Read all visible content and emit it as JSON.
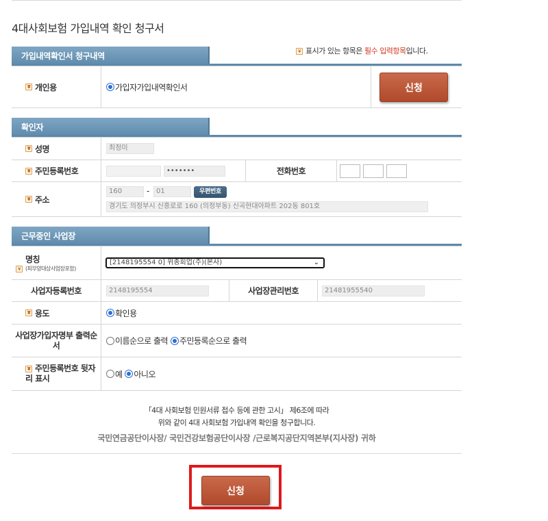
{
  "page": {
    "title": "4대사회보험 가입내역 확인 청구서"
  },
  "required_note": {
    "prefix": "표시가 있는 항목은 ",
    "highlight": "필수 입력항목",
    "suffix": "입니다."
  },
  "required_marker": "¥",
  "section1": {
    "title": "가입내역확인서 청구내역",
    "label": "개인용",
    "option": "가입자가입내역확인서",
    "button": "신청"
  },
  "section2": {
    "title": "확인자",
    "name_label": "성명",
    "name_value": "최정미",
    "rrn_label": "주민등록번호",
    "rrn_back": "•••••••",
    "phone_label": "전화번호",
    "address_label": "주소",
    "zip1": "160",
    "zip_dash": "-",
    "zip2": "01",
    "zip_button": "우편번호",
    "address_value": "경기도 의정부시 신흥로로 160 (의정부동) 신곡현대아파트 202동 801호"
  },
  "section3": {
    "title": "근무중인 사업장",
    "name_label": "명칭",
    "name_sub": "(피부양대상사업장포함)",
    "workplace_select": "[2148195554 0]     위종회업(주)(본사)",
    "bizno_label": "사업자등록번호",
    "bizno_value": "2148195554",
    "mgmt_label": "사업장관리번호",
    "mgmt_value": "21481955540",
    "purpose_label": "용도",
    "purpose_option": "확인용",
    "order_label": "사업장가입자명부 출력순서",
    "order_opt1": "이름순으로 출력",
    "order_opt2": "주민등록순으로 출력",
    "rrn_tail_label": "주민등록번호 뒷자리 표시",
    "rrn_tail_yes": "예",
    "rrn_tail_no": "아니오"
  },
  "notice": {
    "line1": "「4대 사회보험 민원서류 접수 등에 관한 고시」 제6조에 따라",
    "line2": "위와 같이 4대 사회보험 가입내역 확인을 청구합니다.",
    "addressee": "국민연금공단이사장/ 국민건강보험공단이사장 /근로복지공단지역본부(지사장) 귀하"
  },
  "footer": {
    "submit_button": "신청"
  }
}
